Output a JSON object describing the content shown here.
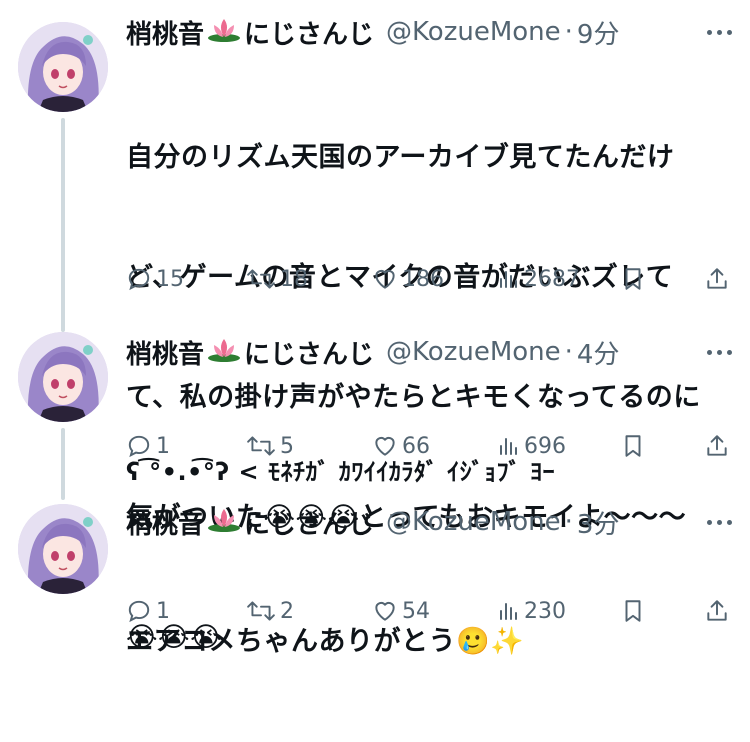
{
  "tweets": [
    {
      "name": "梢桃音",
      "name_suffix": "にじさんじ",
      "handle": "@KozueMone",
      "dot": "·",
      "time": "9分",
      "text_lines": [
        "自分のリズム天国のアーカイブ見てたんだけ",
        "ど、ゲームの音とマイクの音がだいぶズレて",
        "て、私の掛け声がやたらとキモくなってるのに",
        "気がついた😭😭😭とってもおキモイよ〜〜〜",
        "😭😭😭"
      ],
      "replies": "15",
      "retweets": "18",
      "likes": "186",
      "views": "2687"
    },
    {
      "name": "梢桃音",
      "name_suffix": "にじさんじ",
      "handle": "@KozueMone",
      "dot": "·",
      "time": "4分",
      "text_lines": [
        "ʕ ͡°•.•͡°ʔ < ﾓﾈﾁｶﾞ ｶﾜｲｲｶﾗﾀﾞ ｲｼﾞｮﾌﾞ ﾖｰ"
      ],
      "replies": "1",
      "retweets": "5",
      "likes": "66",
      "views": "696"
    },
    {
      "name": "梢桃音",
      "name_suffix": "にじさんじ",
      "handle": "@KozueMone",
      "dot": "·",
      "time": "3分",
      "text_lines": [
        "エアコメちゃんありがとう🥲✨"
      ],
      "replies": "1",
      "retweets": "2",
      "likes": "54",
      "views": "230"
    }
  ]
}
